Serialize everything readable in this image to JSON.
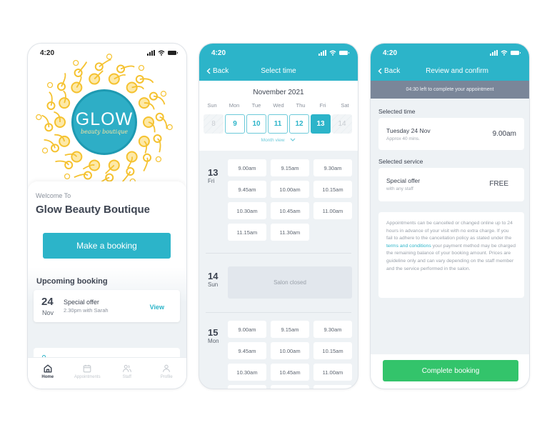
{
  "status_bar": {
    "time": "4:20"
  },
  "colors": {
    "teal": "#2cb4c9",
    "green": "#33c46b",
    "timer_bar": "#7a8699",
    "logo_gold": "#f5c230"
  },
  "home": {
    "logo": {
      "main": "GLOW",
      "sub": "beauty boutique"
    },
    "welcome": "Welcome To",
    "shop_name": "Glow Beauty Boutique",
    "make_booking": "Make a booking",
    "upcoming_title": "Upcoming booking",
    "booking": {
      "day": "24",
      "month": "Nov",
      "title": "Special offer",
      "subtitle": "2.30pm with Sarah",
      "action": "View"
    },
    "tabs": [
      {
        "label": "Home",
        "icon": "home-icon",
        "active": true
      },
      {
        "label": "Appointments",
        "icon": "calendar-icon",
        "active": false
      },
      {
        "label": "Staff",
        "icon": "staff-icon",
        "active": false
      },
      {
        "label": "Profile",
        "icon": "profile-icon",
        "active": false
      }
    ]
  },
  "select_time": {
    "back": "Back",
    "title": "Select time",
    "month": "November 2021",
    "weekdays": [
      "Sun",
      "Mon",
      "Tue",
      "Wed",
      "Thu",
      "Fri",
      "Sat"
    ],
    "dates": [
      {
        "num": "8",
        "state": "disabled"
      },
      {
        "num": "9",
        "state": "available"
      },
      {
        "num": "10",
        "state": "available"
      },
      {
        "num": "11",
        "state": "available"
      },
      {
        "num": "12",
        "state": "available"
      },
      {
        "num": "13",
        "state": "selected"
      },
      {
        "num": "14",
        "state": "disabled"
      }
    ],
    "month_view": "Month view",
    "days": [
      {
        "num": "13",
        "name": "Fri",
        "slots": [
          "9.00am",
          "9.15am",
          "9.30am",
          "9.45am",
          "10.00am",
          "10.15am",
          "10.30am",
          "10.45am",
          "11.00am",
          "11.15am",
          "11.30am"
        ]
      },
      {
        "num": "14",
        "name": "Sun",
        "closed": "Salon closed"
      },
      {
        "num": "15",
        "name": "Mon",
        "slots": [
          "9.00am",
          "9.15am",
          "9.30am",
          "9.45am",
          "10.00am",
          "10.15am",
          "10.30am",
          "10.45am",
          "11.00am",
          "",
          "",
          ""
        ]
      }
    ]
  },
  "review": {
    "back": "Back",
    "title": "Review and confirm",
    "timer": "04:30 left to complete your appointment",
    "selected_time_label": "Selected time",
    "time_card": {
      "title": "Tuesday 24 Nov",
      "subtitle": "Approx 40 mins.",
      "value": "9.00am"
    },
    "selected_service_label": "Selected service",
    "service_card": {
      "title": "Special offer",
      "subtitle": "with any staff",
      "value": "FREE"
    },
    "policy_before": "Appointments can be cancelled or changed online up to 24 hours in advance of your visit with no extra charge. If you fail to adhere to the cancellation policy as stated under the ",
    "policy_link": "terms and conditions",
    "policy_after": " your payment method may be charged the remaining balance of your booking amount. Prices are guideline only and can vary depending on the staff member and the service performed in the salon.",
    "complete_button": "Complete booking"
  }
}
